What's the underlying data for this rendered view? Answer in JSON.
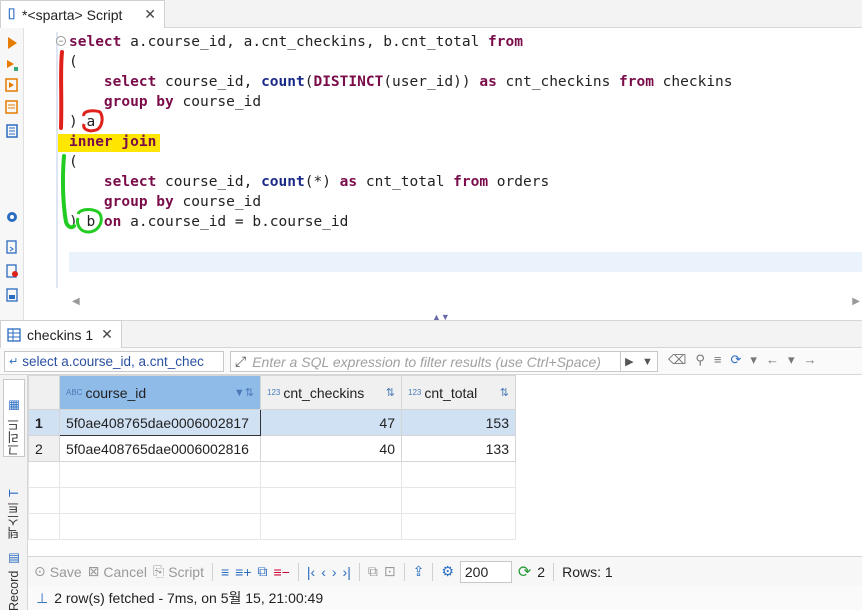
{
  "editor": {
    "tab_title": "*<sparta> Script",
    "code_lines": [
      [
        {
          "t": "select",
          "c": "kw"
        },
        {
          "t": " a.course_id, a.cnt_checkins, b.cnt_total "
        },
        {
          "t": "from",
          "c": "kw"
        }
      ],
      [
        {
          "t": "("
        }
      ],
      [
        {
          "t": "    "
        },
        {
          "t": "select",
          "c": "kw"
        },
        {
          "t": " course_id, "
        },
        {
          "t": "count",
          "c": "fn"
        },
        {
          "t": "("
        },
        {
          "t": "DISTINCT",
          "c": "kw"
        },
        {
          "t": "(user_id)) "
        },
        {
          "t": "as",
          "c": "kw"
        },
        {
          "t": " cnt_checkins "
        },
        {
          "t": "from",
          "c": "kw"
        },
        {
          "t": " checkins"
        }
      ],
      [
        {
          "t": "    "
        },
        {
          "t": "group by",
          "c": "kw"
        },
        {
          "t": " course_id"
        }
      ],
      [
        {
          "t": ") a"
        }
      ],
      [
        {
          "t": "inner join",
          "c": "kw"
        }
      ],
      [
        {
          "t": "("
        }
      ],
      [
        {
          "t": "    "
        },
        {
          "t": "select",
          "c": "kw"
        },
        {
          "t": " course_id, "
        },
        {
          "t": "count",
          "c": "fn"
        },
        {
          "t": "(*) "
        },
        {
          "t": "as",
          "c": "kw"
        },
        {
          "t": " cnt_total "
        },
        {
          "t": "from",
          "c": "kw"
        },
        {
          "t": " orders"
        }
      ],
      [
        {
          "t": "    "
        },
        {
          "t": "group by",
          "c": "kw"
        },
        {
          "t": " course_id"
        }
      ],
      [
        {
          "t": ") b "
        },
        {
          "t": "on",
          "c": "kw"
        },
        {
          "t": " a.course_id = b.course_id"
        }
      ]
    ]
  },
  "results": {
    "tab_title": "checkins 1",
    "query_preview": "select a.course_id, a.cnt_chec",
    "filter_placeholder": "Enter a SQL expression to filter results (use Ctrl+Space)",
    "columns": [
      {
        "name": "course_id",
        "type_tag": "ABC"
      },
      {
        "name": "cnt_checkins",
        "type_tag": "123"
      },
      {
        "name": "cnt_total",
        "type_tag": "123"
      }
    ],
    "rows": [
      {
        "num": "1",
        "course_id": "5f0ae408765dae0006002817",
        "cnt_checkins": "47",
        "cnt_total": "153"
      },
      {
        "num": "2",
        "course_id": "5f0ae408765dae0006002816",
        "cnt_checkins": "40",
        "cnt_total": "133"
      }
    ],
    "side_tabs": {
      "grid": "그리드",
      "text": "텍스트",
      "record": "Record"
    }
  },
  "toolbar": {
    "save_label": "Save",
    "cancel_label": "Cancel",
    "script_label": "Script",
    "fetch_size": "200",
    "refresh_count": "2",
    "rows_label": "Rows: 1"
  },
  "status": {
    "message": "2 row(s) fetched - 7ms, on 5월 15, 21:00:49"
  },
  "annotations": {
    "red": "#e0201a",
    "green": "#22cc22",
    "yellow": "#ffe600"
  }
}
